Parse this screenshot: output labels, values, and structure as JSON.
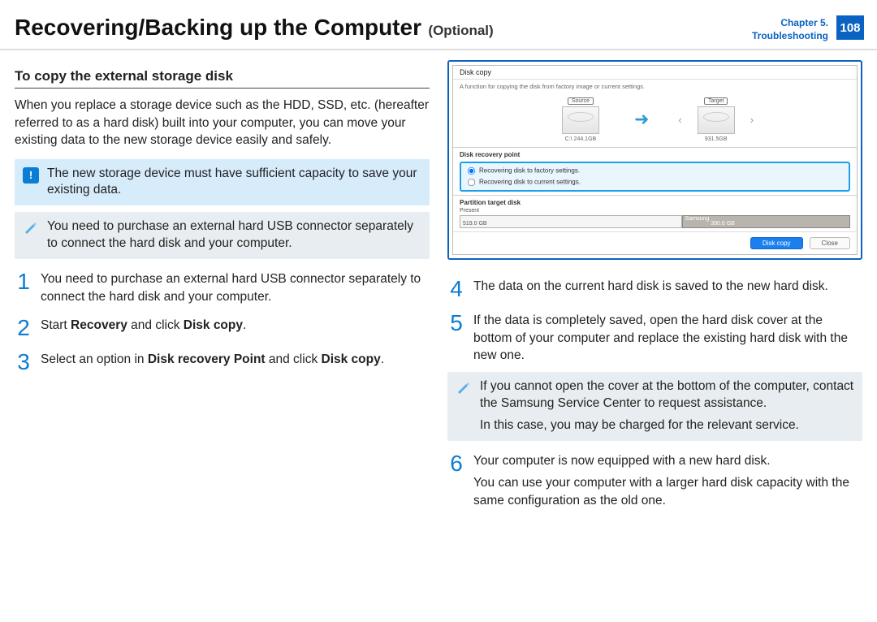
{
  "header": {
    "title_main": "Recovering/Backing up the Computer",
    "title_optional": "(Optional)",
    "chapter_line1": "Chapter 5.",
    "chapter_line2": "Troubleshooting",
    "page_number": "108"
  },
  "left": {
    "heading": "To copy the external storage disk",
    "intro": "When you replace a storage device such as the HDD, SSD, etc. (hereafter referred to as a hard disk) built into your computer, you can move your existing data to the new storage device easily and safely.",
    "callout_alert": "The new storage device must have sufficient capacity to save your existing data.",
    "callout_note": "You need to purchase an external hard USB connector separately to connect the hard disk and your computer.",
    "steps": {
      "1": "You need to purchase an external hard USB connector separately to connect the hard disk and your computer.",
      "2_pre": "Start ",
      "2_b1": "Recovery",
      "2_mid": " and click ",
      "2_b2": "Disk copy",
      "2_post": ".",
      "3_pre": "Select an option in ",
      "3_b1": "Disk recovery Point",
      "3_mid": " and click ",
      "3_b2": "Disk copy",
      "3_post": "."
    }
  },
  "screenshot": {
    "window_title": "Disk copy",
    "description": "A function for copying the disk from factory image or current settings.",
    "source_label": "Source",
    "source_capacity": "C:\\ 244.1GB",
    "target_label": "Target",
    "target_capacity": "931.5GB",
    "recovery_point_label": "Disk recovery point",
    "radio_factory": "Recovering disk to factory settings.",
    "radio_current": "Recovering disk to current settings.",
    "partition_label": "Partition target disk",
    "present_label": "Present",
    "seg_a_label": "519.0 GB",
    "seg_b_title": "Samsung",
    "seg_b_label": "390.6 GB",
    "btn_primary": "Disk copy",
    "btn_close": "Close"
  },
  "right": {
    "steps": {
      "4": "The data on the current hard disk is saved to the new hard disk.",
      "5": "If the data is completely saved, open the hard disk cover at the bottom of your computer and replace the existing hard disk with the new one.",
      "6a": "Your computer is now equipped with a new hard disk.",
      "6b": "You can use your computer with a larger hard disk capacity with the same configuration as the old one."
    },
    "callout_note_p1": "If you cannot open the cover at the bottom of the computer, contact the Samsung Service Center to request assistance.",
    "callout_note_p2": "In this case, you may be charged for the relevant service."
  }
}
